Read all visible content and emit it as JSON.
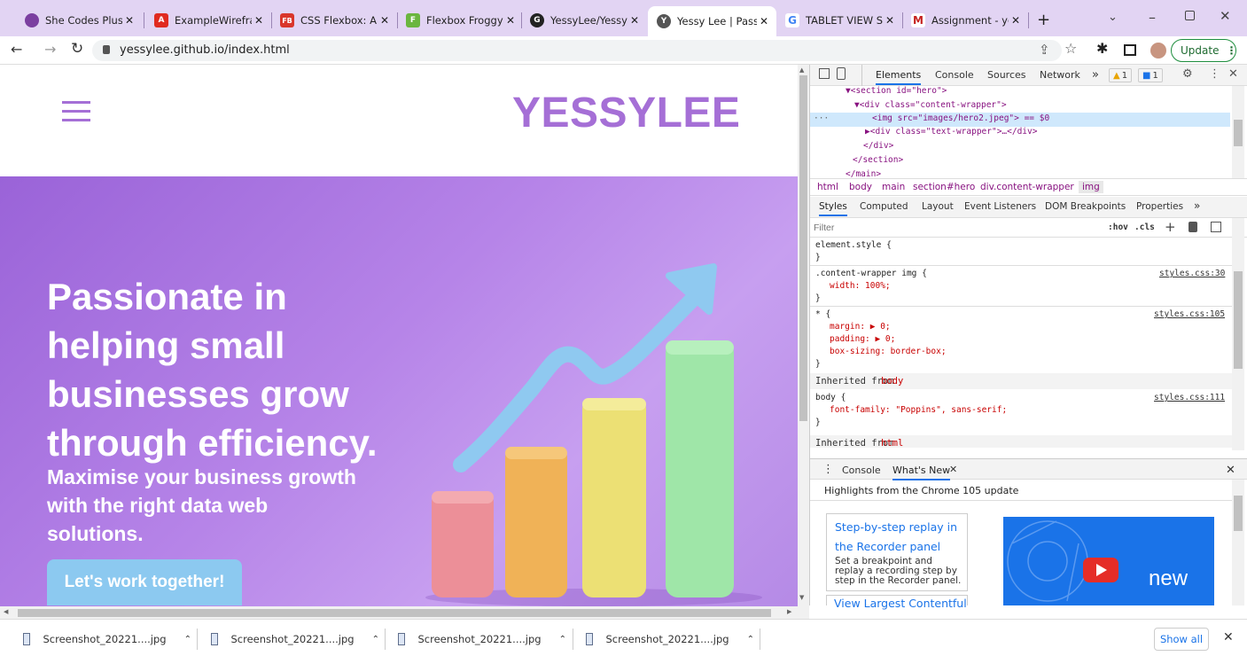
{
  "tabs": [
    {
      "title": "She Codes Plus P",
      "icon": "shecodes-icon",
      "color": "#7b3fa0",
      "glyph": ""
    },
    {
      "title": "ExampleWirefram",
      "icon": "acrobat-icon",
      "color": "#e02b20",
      "glyph": "A"
    },
    {
      "title": "CSS Flexbox: A si",
      "icon": "flexbox-fb-icon",
      "color": "#d9362b",
      "glyph": "FB"
    },
    {
      "title": "Flexbox Froggy -",
      "icon": "froggy-icon",
      "color": "#6bb63f",
      "glyph": "F"
    },
    {
      "title": "YessyLee/YessyLe",
      "icon": "github-icon",
      "color": "#222222",
      "glyph": "G"
    },
    {
      "title": "Yessy Lee | Passio",
      "icon": "globe-icon",
      "color": "#555555",
      "glyph": "Y"
    },
    {
      "title": "TABLET VIEW SPE",
      "icon": "google-icon",
      "color": "#4285f4",
      "glyph": "G"
    },
    {
      "title": "Assignment - yes",
      "icon": "gmail-icon",
      "color": "#c5221f",
      "glyph": "M"
    }
  ],
  "toolbar": {
    "url": "yessylee.github.io/index.html",
    "update_label": "Update"
  },
  "site": {
    "logo": "YESSYLEE",
    "headline_lines": [
      "Passionate in",
      "helping small",
      "businesses grow",
      "through efficiency."
    ],
    "sub_lines": [
      "Maximise your business growth",
      "with the right data web",
      "solutions."
    ],
    "cta": "Let's work together!"
  },
  "devtools": {
    "tabs": [
      "Elements",
      "Console",
      "Sources",
      "Network"
    ],
    "more": "»",
    "warn_count": "1",
    "msg_count": "1",
    "dom_lines": [
      "▼<section id=\"hero\">",
      "▼<div class=\"content-wrapper\">",
      "<img src=\"images/hero2.jpeg\"> == $0",
      "▶<div class=\"text-wrapper\">…</div>",
      "</div>",
      "</section>",
      "</main>"
    ],
    "breadcrumbs": [
      "html",
      "body",
      "main",
      "section#hero",
      "div.content-wrapper",
      "img"
    ],
    "style_tabs": [
      "Styles",
      "Computed",
      "Layout",
      "Event Listeners",
      "DOM Breakpoints",
      "Properties",
      "»"
    ],
    "filter_placeholder": "Filter",
    "hov": ":hov",
    "cls": ".cls",
    "rules": {
      "element_style": "element.style {",
      "close": "}",
      "r1_selector": ".content-wrapper img {",
      "r1_source": "styles.css:30",
      "r1_decl": "width: 100%;",
      "r2_selector": "* {",
      "r2_source": "styles.css:105",
      "r2_margin": "margin: ▶ 0;",
      "r2_padding": "padding: ▶ 0;",
      "r2_box": "box-sizing: border-box;",
      "inherited_body_prefix": "Inherited from",
      "inherited_body": "body",
      "r3_selector": "body {",
      "r3_source": "styles.css:111",
      "r3_decl": "font-family: \"Poppins\", sans-serif;",
      "inherited_html_prefix": "Inherited from",
      "inherited_html": "html"
    },
    "drawer": {
      "tabs": [
        "Console",
        "What's New"
      ],
      "highlights": "Highlights from the Chrome 105 update",
      "card1_title_lines": [
        "Step-by-step replay in",
        "the Recorder panel"
      ],
      "card1_body_lines": [
        "Set a breakpoint and",
        "replay a recording step by",
        "step in the Recorder panel."
      ],
      "card2_title": "View Largest Contentful",
      "video_label": "new"
    }
  },
  "downloads": {
    "items": [
      "Screenshot_20221....jpg",
      "Screenshot_20221....jpg",
      "Screenshot_20221....jpg",
      "Screenshot_20221....jpg"
    ],
    "show_all": "Show all"
  }
}
